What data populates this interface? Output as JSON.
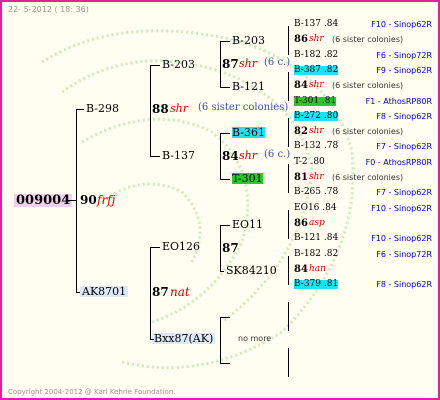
{
  "header": "22- 5-2012 ( 18: 36)",
  "footer": "Copyright 2004-2012 @ Karl Kehrle Foundation.",
  "root": {
    "name": "009004",
    "year": "90",
    "breeder": "frfj"
  },
  "g1": {
    "dam": {
      "name": "B-298",
      "year": "88",
      "breeder": "shr",
      "sisters": "(6 sister colonies)"
    },
    "sire": {
      "name": "AK8701",
      "year": "87",
      "breeder": "nat"
    }
  },
  "g2": [
    {
      "name": "B-203"
    },
    {
      "name": "B-137"
    },
    {
      "name": "EO126"
    },
    {
      "name": "Bxx87(AK)"
    }
  ],
  "g3": [
    {
      "year": "87",
      "breeder": "shr",
      "sisters": "(6 c.)"
    },
    {
      "year": "84",
      "breeder": "shr",
      "sisters": "(6 c.)"
    },
    {
      "year": "87"
    },
    {
      "nomore": "no more"
    }
  ],
  "g3nodes": [
    "B-203",
    "B-121",
    "B-361",
    "T-301",
    "EO11",
    "SK84210"
  ],
  "leaves": [
    {
      "name": "B-137 .84",
      "loc": "F10 - Sinop62R"
    },
    {
      "year": "86",
      "breeder": "shr",
      "sisters": "(6 sister colonies)"
    },
    {
      "name": "B-182 .82",
      "loc": "F6 - Sinop72R"
    },
    {
      "name": "B-387 .82",
      "loc": "F9 - Sinop62R",
      "hl": "cyan"
    },
    {
      "year": "84",
      "breeder": "shr",
      "sisters": "(6 sister colonies)"
    },
    {
      "name": "T-301 .81",
      "loc": "F1 - AthosRP80R",
      "hl": "green"
    },
    {
      "name": "B-272 .80",
      "loc": "F8 - Sinop62R",
      "hl": "cyan"
    },
    {
      "year": "82",
      "breeder": "shr",
      "sisters": "(6 sister colonies)"
    },
    {
      "name": "B-132 .78",
      "loc": "F7 - Sinop62R"
    },
    {
      "name": "T-2 .80",
      "loc": "F0 - AthosRP80R"
    },
    {
      "year": "81",
      "breeder": "shr",
      "sisters": "(6 sister colonies)"
    },
    {
      "name": "B-265 .78",
      "loc": "F7 - Sinop62R"
    },
    {
      "name": "EO16 .84",
      "loc": "F10 - Sinop62R"
    },
    {
      "year": "86",
      "breeder": "asp"
    },
    {
      "name": "B-121 .84",
      "loc": "F10 - Sinop62R"
    },
    {
      "name": "B-182 .82",
      "loc": "F6 - Sinop72R"
    },
    {
      "year": "84",
      "breeder": "han"
    },
    {
      "name": "B-379 .81",
      "loc": "F8 - Sinop62R",
      "hl": "cyan"
    }
  ],
  "colors": {
    "frame": "#e020a0",
    "root_bg": "#f0d0f0",
    "cyan": "#22e0f0",
    "green": "#22cc22",
    "breeder": "#d00000",
    "location": "#0000c0"
  }
}
